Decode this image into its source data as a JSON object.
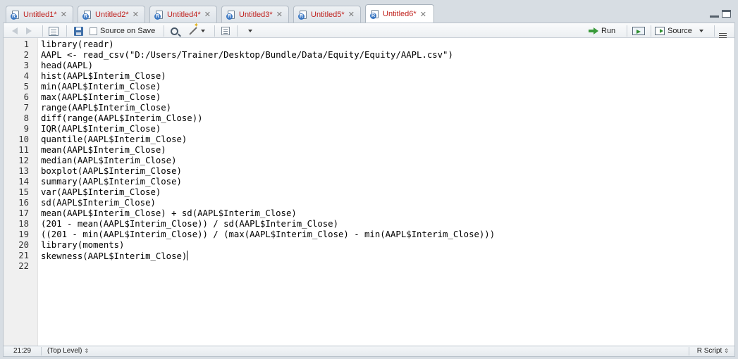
{
  "tabs": [
    {
      "label": "Untitled1*",
      "active": false
    },
    {
      "label": "Untitled2*",
      "active": false
    },
    {
      "label": "Untitled4*",
      "active": false
    },
    {
      "label": "Untitled3*",
      "active": false
    },
    {
      "label": "Untitled5*",
      "active": false
    },
    {
      "label": "Untitled6*",
      "active": true
    }
  ],
  "toolbar": {
    "source_on_save_label": "Source on Save",
    "run_label": "Run",
    "source_label": "Source"
  },
  "editor": {
    "lines": [
      {
        "n": "1",
        "text": "library(readr)"
      },
      {
        "n": "2",
        "text": "AAPL <- read_csv(\"D:/Users/Trainer/Desktop/Bundle/Data/Equity/Equity/AAPL.csv\")"
      },
      {
        "n": "3",
        "text": "head(AAPL)"
      },
      {
        "n": "4",
        "text": "hist(AAPL$Interim_Close)"
      },
      {
        "n": "5",
        "text": "min(AAPL$Interim_Close)"
      },
      {
        "n": "6",
        "text": "max(AAPL$Interim_Close)"
      },
      {
        "n": "7",
        "text": "range(AAPL$Interim_Close)"
      },
      {
        "n": "8",
        "text": "diff(range(AAPL$Interim_Close))"
      },
      {
        "n": "9",
        "text": "IQR(AAPL$Interim_Close)"
      },
      {
        "n": "10",
        "text": "quantile(AAPL$Interim_Close)"
      },
      {
        "n": "11",
        "text": "mean(AAPL$Interim_Close)"
      },
      {
        "n": "12",
        "text": "median(AAPL$Interim_Close)"
      },
      {
        "n": "13",
        "text": "boxplot(AAPL$Interim_Close)"
      },
      {
        "n": "14",
        "text": "summary(AAPL$Interim_Close)"
      },
      {
        "n": "15",
        "text": "var(AAPL$Interim_Close)"
      },
      {
        "n": "16",
        "text": "sd(AAPL$Interim_Close)"
      },
      {
        "n": "17",
        "text": "mean(AAPL$Interim_Close) + sd(AAPL$Interim_Close)"
      },
      {
        "n": "18",
        "text": "(201 - mean(AAPL$Interim_Close)) / sd(AAPL$Interim_Close)"
      },
      {
        "n": "19",
        "text": "((201 - min(AAPL$Interim_Close)) / (max(AAPL$Interim_Close) - min(AAPL$Interim_Close)))"
      },
      {
        "n": "20",
        "text": "library(moments)"
      },
      {
        "n": "21",
        "text": "skewness(AAPL$Interim_Close)"
      },
      {
        "n": "22",
        "text": ""
      }
    ]
  },
  "status": {
    "cursor_position": "21:29",
    "scope": "(Top Level)",
    "file_type": "R Script"
  }
}
